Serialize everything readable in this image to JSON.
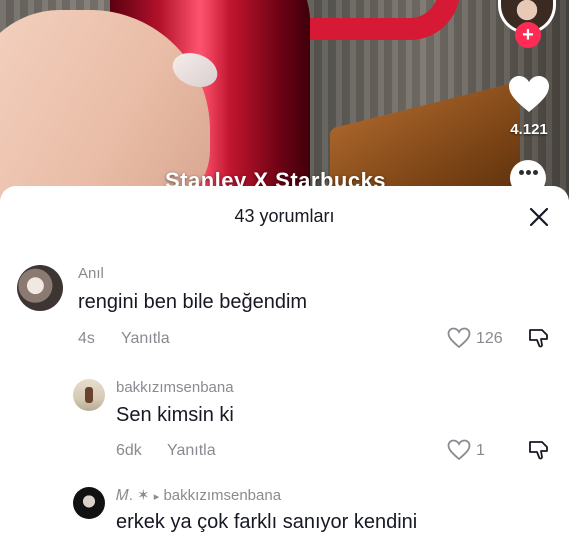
{
  "video": {
    "caption": "Stanley X Starbucks",
    "like_count": "4.121",
    "follow_symbol": "+"
  },
  "comments_sheet": {
    "title": "43 yorumları",
    "close_symbol": "✕",
    "comments": [
      {
        "username": "Anıl",
        "text": "rengini ben bile beğendim",
        "time": "4s",
        "reply_label": "Yanıtla",
        "likes": "126"
      },
      {
        "username": "bakkızımsenbana",
        "text": "Sen kimsin ki",
        "time": "6dk",
        "reply_label": "Yanıtla",
        "likes": "1"
      },
      {
        "username": "𝑀. ✶",
        "reply_arrow": "▸",
        "reply_to": "bakkızımsenbana",
        "text": "erkek ya çok farklı sanıyor kendini"
      }
    ]
  },
  "colors": {
    "accent": "#fe2c55",
    "muted_text": "#8a8b91",
    "primary_text": "#161823"
  }
}
